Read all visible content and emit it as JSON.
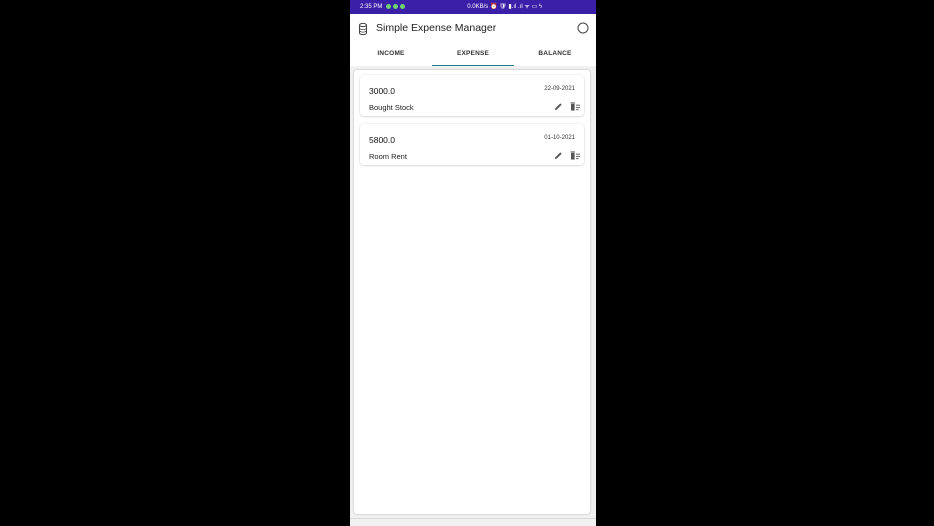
{
  "status_bar": {
    "time": "2:35 PM",
    "indicators": "0.0KB/s ⏰ 🛡 ▮.ıl .ıl ᯤ ▭ ϟ"
  },
  "app_bar": {
    "title": "Simple Expense Manager",
    "logo_icon": "coins-icon",
    "action_icon": "circle-icon"
  },
  "tabs": [
    {
      "label": "INCOME",
      "active": false
    },
    {
      "label": "EXPENSE",
      "active": true
    },
    {
      "label": "BALANCE",
      "active": false
    }
  ],
  "expenses": [
    {
      "amount": "3000.0",
      "date": "22-09-2021",
      "description": "Bought Stock"
    },
    {
      "amount": "5800.0",
      "date": "01-10-2021",
      "description": "Room Rent"
    }
  ],
  "colors": {
    "status_bar": "#3a1fa8",
    "tab_indicator": "#1d7f86"
  }
}
